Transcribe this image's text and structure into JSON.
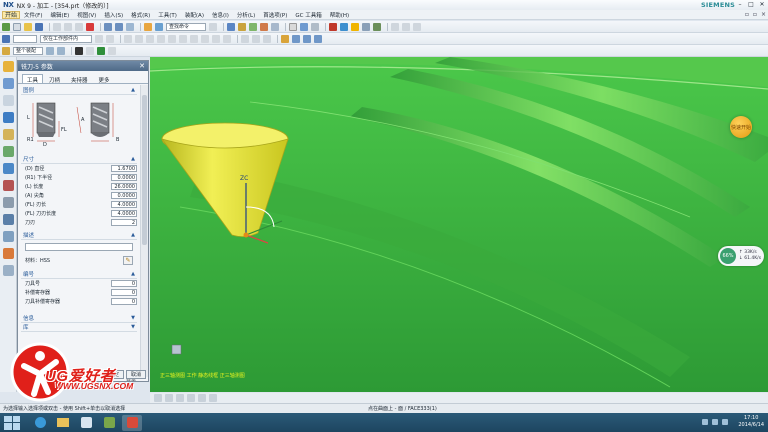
{
  "window": {
    "logo": "NX",
    "title": "NX 9 - 加工 - [354.prt（修改的）]",
    "brand": "SIEMENS",
    "controls": [
      "–",
      "□",
      "✕"
    ]
  },
  "menu": {
    "start": "开始",
    "items": [
      "文件(F)",
      "编辑(E)",
      "视图(V)",
      "插入(S)",
      "格式(R)",
      "工具(T)",
      "装配(A)",
      "信息(I)",
      "分析(L)",
      "首选项(P)",
      "GC 工具箱",
      "帮助(H)"
    ]
  },
  "toolbar": {
    "command_finder": "查找命令",
    "filter": "仅在工作部件内",
    "selection_combo": "整个装配"
  },
  "dialog": {
    "title": "铣刀-5 参数",
    "close": "✕",
    "tabs": [
      "工具",
      "刀柄",
      "夹持器",
      "更多"
    ],
    "active_tab": 0,
    "sections": {
      "image": "图例",
      "dimensions": "尺寸",
      "description": "描述",
      "numbering": "编号",
      "info": "信息",
      "library": "库"
    },
    "dimension_rows": [
      {
        "label": "(D) 直径",
        "value": "1.6700"
      },
      {
        "label": "(R1) 下半径",
        "value": "0.0000"
      },
      {
        "label": "(L) 长度",
        "value": "26.0000"
      },
      {
        "label": "(A) 尖角",
        "value": "0.0000"
      },
      {
        "label": "(FL) 刃长",
        "value": "4.0000"
      },
      {
        "label": "(FL) 刀刃长度",
        "value": "4.0000"
      },
      {
        "label": "刀刃",
        "value": "2"
      }
    ],
    "material_label": "材料：HSS",
    "numbering_rows": [
      {
        "label": "刀具号",
        "value": "0"
      },
      {
        "label": "补偿寄存器",
        "value": "0"
      },
      {
        "label": "刀具补偿寄存器",
        "value": "0"
      }
    ],
    "preview_label": "预览",
    "show_label": "显示",
    "ok_label": "确定",
    "cancel_label": "取消",
    "diagram_labels": {
      "R1": "R1",
      "D": "D",
      "FL": "FL",
      "L": "L",
      "A": "A",
      "B": "B"
    }
  },
  "viewport": {
    "axis_label": "ZC",
    "badge_text": "快速开始",
    "hint": "正三轴测图  工作 静态线框  正三轴测图",
    "net_percent": "66%",
    "net_up": "↑ 33K/s",
    "net_down": "↓ 61.4K/s",
    "colors": {
      "background": "#33a63a",
      "cone": "#e6e63a",
      "ribs": "#6fdc5a"
    }
  },
  "statusbar": {
    "left": "为选择输入选择项或双击 - 使用 Shift+单击以取消选择",
    "middle": "点在曲面上 - 面 / FACE333(1)"
  },
  "taskbar": {
    "time": "17:10",
    "date": "2014/6/14"
  },
  "watermark": {
    "text": "UG爱好者",
    "url": "WWW.UGSNX.COM"
  }
}
